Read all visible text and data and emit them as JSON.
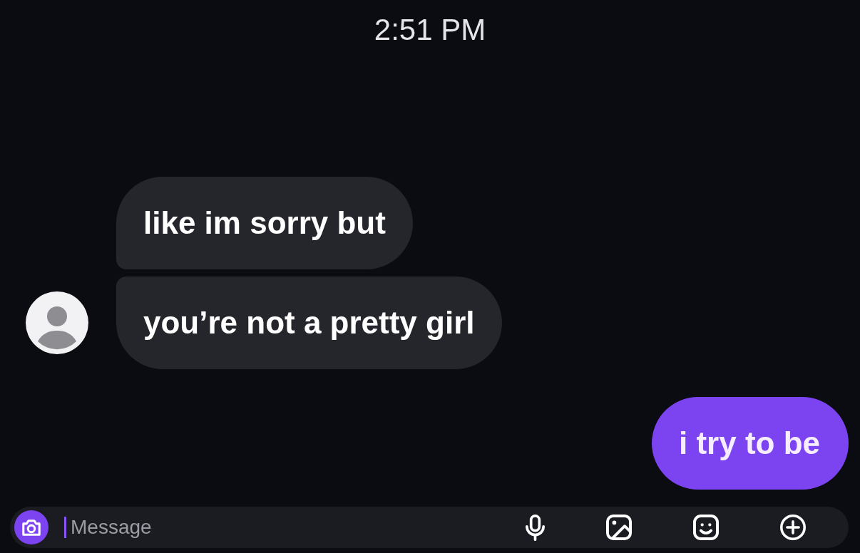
{
  "timestamp": "2:51 PM",
  "messages": [
    {
      "kind": "received",
      "text": "like im sorry but",
      "avatar": false
    },
    {
      "kind": "received",
      "text": "you’re not a pretty girl",
      "avatar": true
    },
    {
      "kind": "sent",
      "text": "i try to be"
    }
  ],
  "composer": {
    "placeholder": "Message"
  }
}
